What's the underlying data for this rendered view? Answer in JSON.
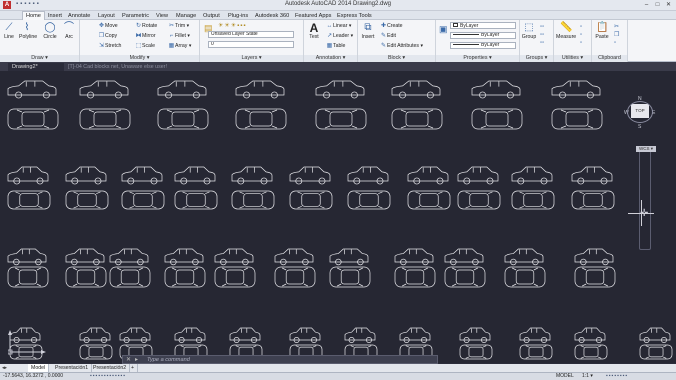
{
  "window": {
    "title": "Autodesk AutoCAD 2014    Drawing2.dwg",
    "minimize": "–",
    "maximize": "□",
    "close": "✕"
  },
  "menu": {
    "tabs": [
      "Home",
      "Insert",
      "Annotate",
      "Layout",
      "Parametric",
      "View",
      "Manage",
      "Output",
      "Plug-ins",
      "Autodesk 360",
      "Featured Apps",
      "Express Tools"
    ],
    "active": "Home"
  },
  "ribbon": {
    "draw": {
      "title": "Draw ▾",
      "tools": [
        "Line",
        "Polyline",
        "Circle",
        "Arc"
      ]
    },
    "modify": {
      "title": "Modify ▾",
      "tools": [
        "Move",
        "Rotate",
        "Trim ▾",
        "Copy",
        "Mirror",
        "Fillet ▾",
        "Stretch",
        "Scale",
        "Array ▾"
      ]
    },
    "layers": {
      "title": "Layers ▾",
      "state_combo": "Unsaved Layer State",
      "layer_combo": "0"
    },
    "annotation": {
      "title": "Annotation ▾",
      "text_tool": "Text",
      "tools": [
        "Linear ▾",
        "Leader ▾",
        "Table"
      ]
    },
    "block": {
      "title": "Block ▾",
      "insert_tool": "Insert",
      "tools": [
        "Create",
        "Edit",
        "Edit Attributes ▾"
      ]
    },
    "properties": {
      "title": "Properties ▾",
      "color": "ByLayer",
      "linetype": "ByLayer",
      "lineweight": "ByLayer"
    },
    "groups": {
      "title": "Groups ▾",
      "tool": "Group"
    },
    "utilities": {
      "title": "Utilities ▾",
      "tool": "Measure"
    },
    "clipboard": {
      "title": "Clipboard",
      "tool": "Paste"
    }
  },
  "file_tabs": {
    "document": "Drawing2*",
    "warning": "[T]-04 Cad blocks net, Unaware else user!"
  },
  "viewcube": {
    "top": "TOP",
    "north": "N",
    "south": "S",
    "east": "E",
    "west": "W",
    "wcs": "WCS ▾"
  },
  "command": {
    "close": "✕",
    "prompt": "Type a command"
  },
  "layout_tabs": [
    "Model",
    "Presentación1",
    "Presentación2",
    "+"
  ],
  "status": {
    "coords": "-17.5643, 16.3272 , 0.0000",
    "model": "MODEL",
    "scale": "1:1 ▾"
  },
  "colors": {
    "background": "#262733",
    "linework": "#e8e8ec",
    "ribbon": "#f4f5f8",
    "accent": "#2f5f9e"
  }
}
